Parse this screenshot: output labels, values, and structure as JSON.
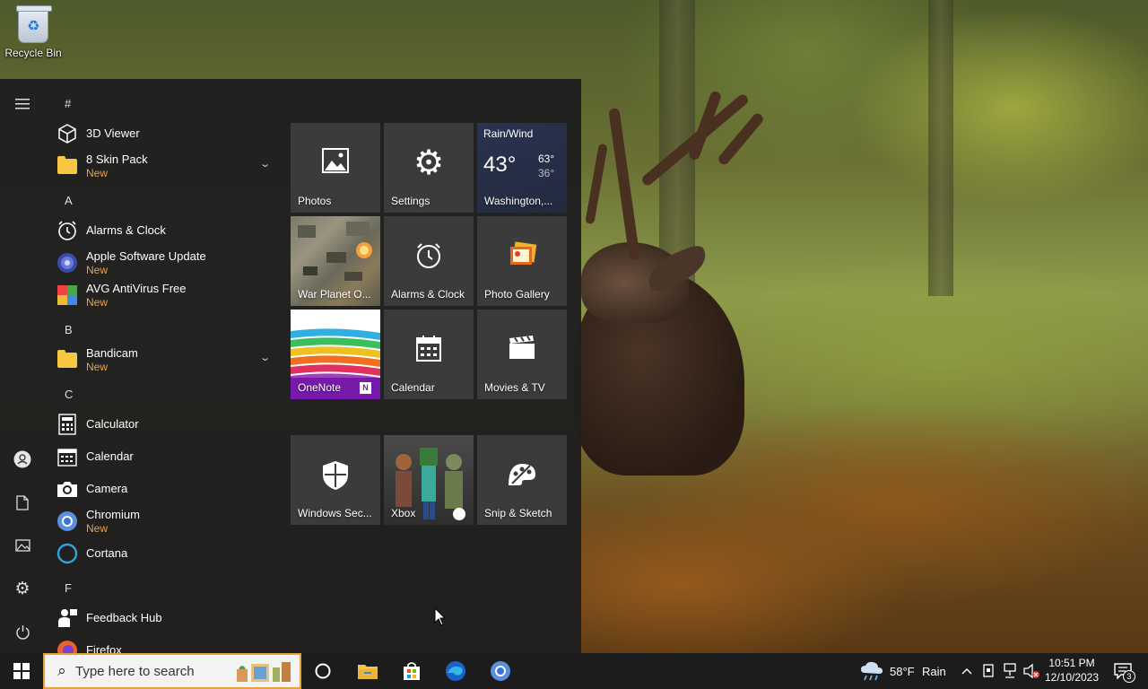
{
  "desktop": {
    "recycle_bin_label": "Recycle Bin"
  },
  "start_menu": {
    "app_list": {
      "groups": [
        {
          "letter": "#"
        },
        {
          "letter": "A"
        },
        {
          "letter": "B"
        },
        {
          "letter": "C"
        },
        {
          "letter": "F"
        }
      ],
      "items": [
        {
          "name": "3D Viewer",
          "badge": ""
        },
        {
          "name": "8 Skin Pack",
          "badge": "New"
        },
        {
          "name": "Alarms & Clock",
          "badge": ""
        },
        {
          "name": "Apple Software Update",
          "badge": "New"
        },
        {
          "name": "AVG AntiVirus Free",
          "badge": "New"
        },
        {
          "name": "Bandicam",
          "badge": "New"
        },
        {
          "name": "Calculator",
          "badge": ""
        },
        {
          "name": "Calendar",
          "badge": ""
        },
        {
          "name": "Camera",
          "badge": ""
        },
        {
          "name": "Chromium",
          "badge": "New"
        },
        {
          "name": "Cortana",
          "badge": ""
        },
        {
          "name": "Feedback Hub",
          "badge": ""
        },
        {
          "name": "Firefox",
          "badge": ""
        }
      ]
    },
    "tiles": {
      "photos": "Photos",
      "settings": "Settings",
      "weather": {
        "condition": "Rain/Wind",
        "temp": "43°",
        "high": "63°",
        "low": "36°",
        "location": "Washington,..."
      },
      "war_planet": "War Planet O...",
      "alarms": "Alarms & Clock",
      "photo_gallery": "Photo Gallery",
      "onenote": "OneNote",
      "calendar": "Calendar",
      "movies": "Movies & TV",
      "windows_security": "Windows Sec...",
      "xbox": "Xbox",
      "snip": "Snip & Sketch"
    }
  },
  "taskbar": {
    "search_placeholder": "Type here to search",
    "weather_temp": "58°F",
    "weather_condition": "Rain",
    "time": "10:51 PM",
    "date": "12/10/2023",
    "notification_count": "3"
  },
  "colors": {
    "accent_orange": "#e8a23c",
    "new_badge": "#e8a24a",
    "onenote_purple": "#7719aa",
    "tile_bg": "#3b3b3b"
  }
}
